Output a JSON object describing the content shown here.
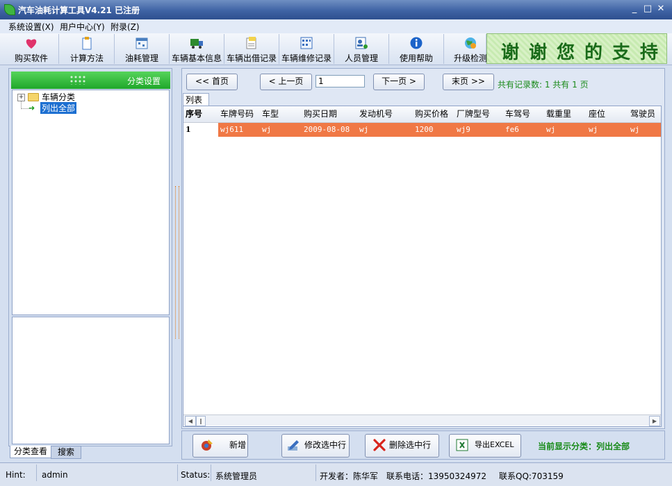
{
  "window": {
    "title": "汽车油耗计算工具V4.21 已注册",
    "minimize": "_",
    "maximize": "□",
    "close": "✕"
  },
  "menu": [
    "系统设置(X)",
    "用户中心(Y)",
    "附录(Z)"
  ],
  "toolbar": [
    {
      "label": "购买软件",
      "icon": "heart-icon",
      "color": "#e0336b"
    },
    {
      "label": "计算方法",
      "icon": "clipboard-icon",
      "color": "#3f78c8"
    },
    {
      "label": "油耗管理",
      "icon": "calendar-icon",
      "color": "#4a7fc0"
    },
    {
      "label": "车辆基本信息",
      "icon": "truck-icon",
      "color": "#2d8a2d"
    },
    {
      "label": "车辆出借记录",
      "icon": "note-icon",
      "color": "#e3a21a"
    },
    {
      "label": "车辆维修记录",
      "icon": "grid-icon",
      "color": "#3a6fc0"
    },
    {
      "label": "人员管理",
      "icon": "user-card-icon",
      "color": "#3b6fb5"
    },
    {
      "label": "使用帮助",
      "icon": "info-icon",
      "color": "#1b63c9"
    },
    {
      "label": "升级检测",
      "icon": "globe-icon",
      "color": "#2f8fd0"
    }
  ],
  "banner": "谢谢您的支持",
  "category_panel": {
    "header": "分类设置",
    "tree": {
      "root": "车辆分类",
      "child": "列出全部"
    },
    "tabs": [
      "分类查看",
      "搜索"
    ]
  },
  "pager": {
    "first": "<< 首页",
    "prev": "< 上一页",
    "page_value": "1",
    "next": "下一页 >",
    "last": "末页 >>",
    "summary": "共有记录数: 1   共有 1 页"
  },
  "list_tab": "列表",
  "table": {
    "columns": [
      "序号",
      "车牌号码",
      "车型",
      "购买日期",
      "发动机号",
      "购买价格",
      "厂牌型号",
      "车驾号",
      "载重里",
      "座位",
      "驾驶员"
    ],
    "rows": [
      [
        "1",
        "wj611",
        "wj",
        "2009-08-08",
        "wj",
        "1200",
        "wj9",
        "fe6",
        "wj",
        "wj",
        "wj"
      ]
    ]
  },
  "actions": [
    {
      "label": "新增",
      "icon": "add-icon"
    },
    {
      "label": "修改选中行",
      "icon": "edit-icon"
    },
    {
      "label": "删除选中行",
      "icon": "delete-icon"
    },
    {
      "label": "导出EXCEL",
      "icon": "excel-icon"
    }
  ],
  "current_category": "当前显示分类：列出全部",
  "status": {
    "hint_label": "Hint:",
    "hint_value": "admin",
    "status_label": "Status:",
    "status_value": "系统管理员",
    "developer": "开发者：陈华军",
    "phone": "联系电话：13950324972",
    "qq": "联系QQ:703159"
  }
}
